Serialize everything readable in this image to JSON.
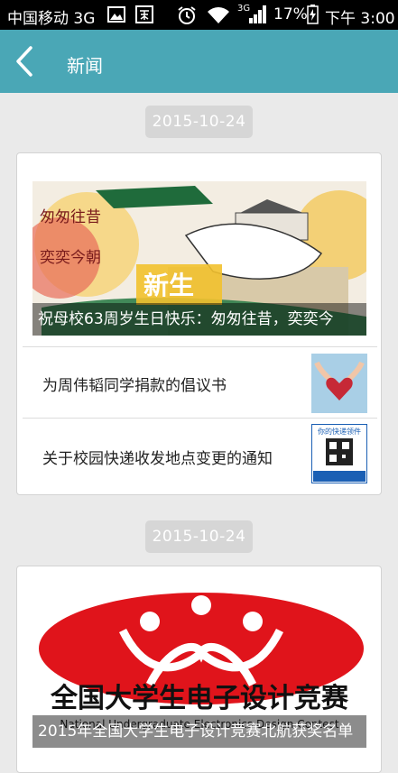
{
  "status_bar": {
    "carrier": "中国移动 3G",
    "network_badge": "3G",
    "battery": "17%",
    "time": "下午 3:00",
    "icons": [
      "image-icon",
      "app-notification-icon",
      "alarm-icon",
      "wifi-icon",
      "signal-icon",
      "battery-charging-icon"
    ]
  },
  "appbar": {
    "title": "新闻",
    "back_icon": "chevron-left-icon"
  },
  "groups": [
    {
      "date": "2015-10-24",
      "hero": {
        "caption": "祝母校63周岁生日快乐：匆匆往昔，奕奕今",
        "art_text": [
          "匆匆往昔",
          "奕奕今朝",
          "新生"
        ]
      },
      "items": [
        {
          "title": "为周伟韬同学捐款的倡议书"
        },
        {
          "title": "关于校园快递收发地点变更的通知",
          "thumb_text": "你的快递领件"
        }
      ]
    },
    {
      "date": "2015-10-24",
      "hero": {
        "caption": "2015年全国大学生电子设计竞赛北航获奖名单",
        "logo_text": "全国大学生电子设计竞赛",
        "logo_text_en": "National Undergraduate Electronics Design Contest"
      }
    }
  ],
  "colors": {
    "accent": "#4aa7b6",
    "chip": "#d6d6d6",
    "background": "#eaeaea",
    "logo_red": "#e0141b"
  }
}
